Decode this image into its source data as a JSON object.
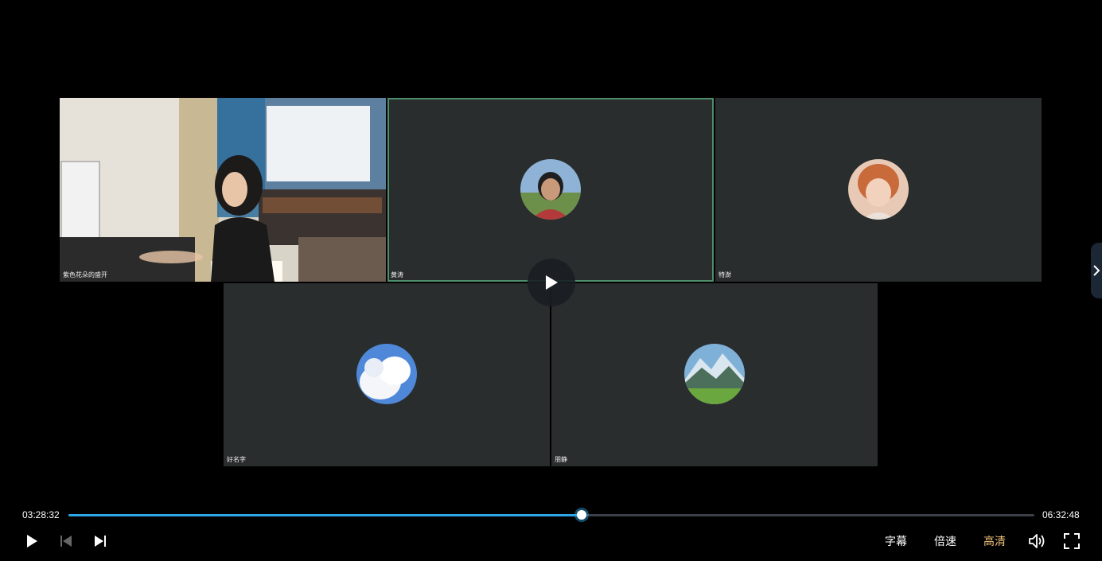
{
  "player": {
    "current_time": "03:28:32",
    "total_time": "06:32:48",
    "progress_fraction": 0.531,
    "accent_color": "#2ea6e8"
  },
  "participants": [
    {
      "name": "紫色花朵的盛开",
      "type": "camera"
    },
    {
      "name": "黄涛",
      "type": "avatar",
      "active": true
    },
    {
      "name": "特澍",
      "type": "avatar"
    },
    {
      "name": "好名字",
      "type": "avatar"
    },
    {
      "name": "朋静",
      "type": "avatar"
    }
  ],
  "controls": {
    "subtitles_label": "字幕",
    "speed_label": "倍速",
    "quality_label": "高清"
  },
  "icons": [
    "play-icon",
    "previous-icon",
    "next-icon",
    "volume-icon",
    "fullscreen-icon",
    "chevron-right-icon"
  ]
}
